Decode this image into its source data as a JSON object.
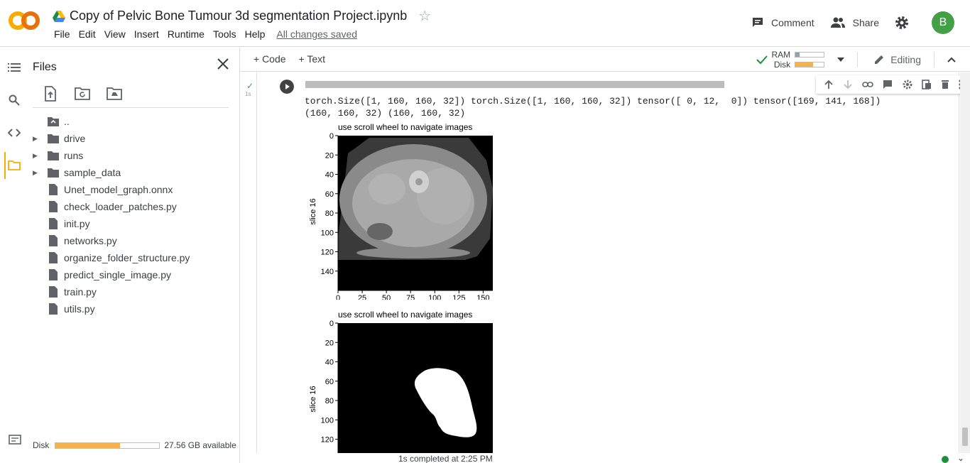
{
  "header": {
    "title": "Copy of Pelvic Bone Tumour 3d segmentation Project.ipynb",
    "menu": [
      "File",
      "Edit",
      "View",
      "Insert",
      "Runtime",
      "Tools",
      "Help"
    ],
    "save_status": "All changes saved",
    "comment_label": "Comment",
    "share_label": "Share",
    "avatar_letter": "B"
  },
  "sidebar": {
    "title": "Files",
    "items": [
      {
        "label": "..",
        "type": "up"
      },
      {
        "label": "drive",
        "type": "folder"
      },
      {
        "label": "runs",
        "type": "folder"
      },
      {
        "label": "sample_data",
        "type": "folder"
      },
      {
        "label": "Unet_model_graph.onnx",
        "type": "file"
      },
      {
        "label": "check_loader_patches.py",
        "type": "file"
      },
      {
        "label": "init.py",
        "type": "file"
      },
      {
        "label": "networks.py",
        "type": "file"
      },
      {
        "label": "organize_folder_structure.py",
        "type": "file"
      },
      {
        "label": "predict_single_image.py",
        "type": "file"
      },
      {
        "label": "train.py",
        "type": "file"
      },
      {
        "label": "utils.py",
        "type": "file"
      }
    ],
    "disk_label": "Disk",
    "disk_available": "27.56 GB available",
    "disk_used_fraction": 0.62
  },
  "toolbar": {
    "code_label": "+ Code",
    "text_label": "+ Text",
    "ram_label": "RAM",
    "disk_label": "Disk",
    "ram_used_fraction": 0.15,
    "disk_used_fraction": 0.62,
    "editing_label": "Editing"
  },
  "cell": {
    "exec_time": "1s",
    "output_line1": "torch.Size([1, 160, 160, 32]) torch.Size([1, 160, 160, 32]) tensor([ 0, 12,  0]) tensor([169, 141, 168])",
    "output_line2": "(160, 160, 32) (160, 160, 32)"
  },
  "plots": [
    {
      "title": "use scroll wheel to navigate images",
      "ylabel": "slice 16",
      "yticks": [
        "0",
        "20",
        "40",
        "60",
        "80",
        "100",
        "120",
        "140"
      ],
      "xticks": [
        "0",
        "25",
        "50",
        "75",
        "100",
        "125",
        "150"
      ]
    },
    {
      "title": "use scroll wheel to navigate images",
      "ylabel": "slice 16",
      "yticks": [
        "0",
        "20",
        "40",
        "60",
        "80",
        "100",
        "120"
      ]
    }
  ],
  "status": {
    "text": "1s    completed at 2:25 PM"
  },
  "colors": {
    "accent_orange": "#f9ab00",
    "bar_orange": "#f4b24f",
    "green": "#1e8e3e"
  }
}
